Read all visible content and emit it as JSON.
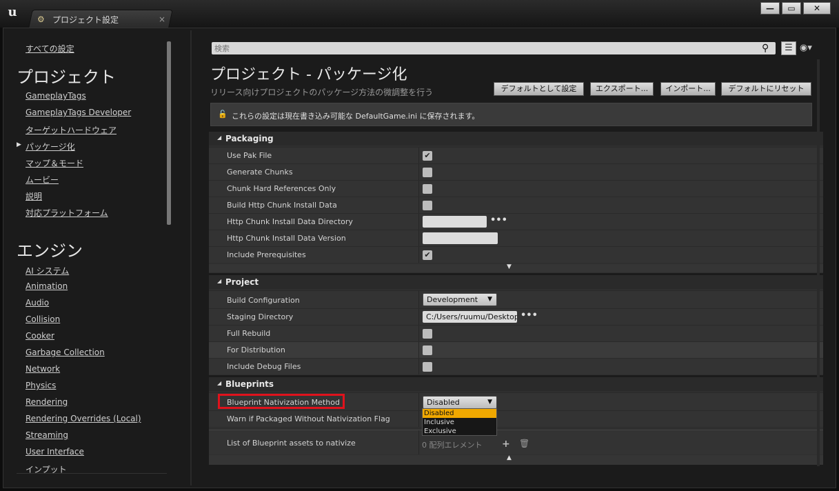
{
  "window": {
    "tab_title": "プロジェクト設定",
    "tab_close": "×",
    "logo": "u",
    "min_label": "—",
    "max_label": "▭",
    "close_label": "✕"
  },
  "sidebar": {
    "all_settings": "すべての設定",
    "project_heading": "プロジェクト",
    "project_items": [
      "GameplayTags",
      "GameplayTags Developer",
      "ターゲットハードウェア",
      "パッケージ化",
      "マップ＆モード",
      "ムービー",
      "説明",
      "対応プラットフォーム"
    ],
    "engine_heading": "エンジン",
    "engine_items": [
      "AI システム",
      "Animation",
      "Audio",
      "Collision",
      "Cooker",
      "Garbage Collection",
      "Network",
      "Physics",
      "Rendering",
      "Rendering Overrides (Local)",
      "Streaming",
      "User Interface",
      "インプット"
    ]
  },
  "search": {
    "placeholder": "検索"
  },
  "header": {
    "title": "プロジェクト - パッケージ化",
    "subtitle": "リリース向けプロジェクトのパッケージ方法の微調整を行う",
    "buttons": [
      "デフォルトとして設定",
      "エクスポート...",
      "インポート...",
      "デフォルトにリセット"
    ]
  },
  "notice": {
    "text": "これらの設定は現在書き込み可能な DefaultGame.ini に保存されます。"
  },
  "sections": {
    "packaging": {
      "title": "Packaging",
      "rows": [
        "Use Pak File",
        "Generate Chunks",
        "Chunk Hard References Only",
        "Build Http Chunk Install Data",
        "Http Chunk Install Data Directory",
        "Http Chunk Install Data Version",
        "Include Prerequisites"
      ],
      "checked": [
        true,
        false,
        false,
        false,
        null,
        null,
        true
      ]
    },
    "project": {
      "title": "Project",
      "rows": [
        "Build Configuration",
        "Staging Directory",
        "Full Rebuild",
        "For Distribution",
        "Include Debug Files"
      ],
      "build_configuration": "Development",
      "staging_directory": "C:/Users/ruumu/Desktop"
    },
    "blueprints": {
      "title": "Blueprints",
      "rows": [
        "Blueprint Nativization Method",
        "Warn if Packaged Without Nativization Flag",
        "List of Blueprint assets to nativize"
      ],
      "nativization_method": "Disabled",
      "dropdown_options": [
        "Disabled",
        "Inclusive",
        "Exclusive"
      ],
      "array_count": "0 配列エレメント"
    }
  },
  "icons": {
    "checkmark": "✔",
    "ellipsis": "•••",
    "collapse": "◢",
    "expand_down": "▼",
    "expand_up": "▲",
    "add": "+",
    "trash": "🗑"
  },
  "colors": {
    "highlight": "#e0121c",
    "selected_option": "#f0a800"
  }
}
